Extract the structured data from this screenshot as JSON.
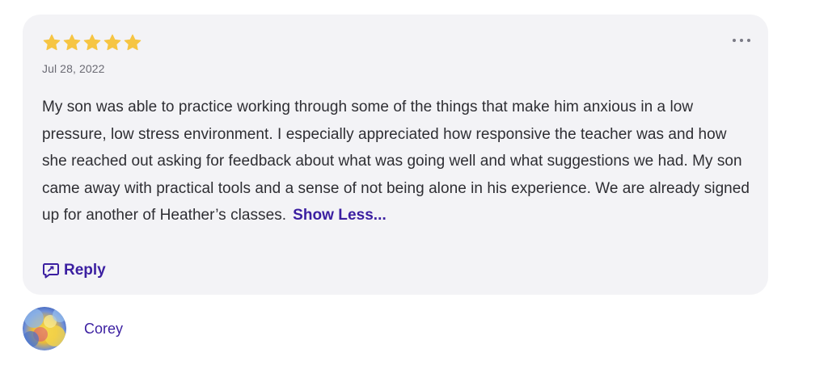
{
  "review": {
    "rating": 5,
    "max_rating": 5,
    "star_color": "#f6c543",
    "date": "Jul 28, 2022",
    "body": "My son was able to practice working through some of the things that make him anxious in a low pressure, low stress environment. I especially appreciated how responsive the teacher was and how she reached out asking for feedback about what was going well and what suggestions we had.  My son came away with practical tools and a sense of not being alone in his experience.  We are already signed up for another of Heather’s classes.",
    "show_less_label": "Show Less...",
    "reply_label": "Reply",
    "more_icon": "more-horizontal-icon",
    "reply_icon": "reply-icon"
  },
  "author": {
    "name": "Corey",
    "avatar_icon": "avatar-image"
  },
  "colors": {
    "accent": "#3b1fa1",
    "card_background": "#f3f3f6",
    "text": "#2e2e33",
    "muted_text": "#6b6b74"
  }
}
